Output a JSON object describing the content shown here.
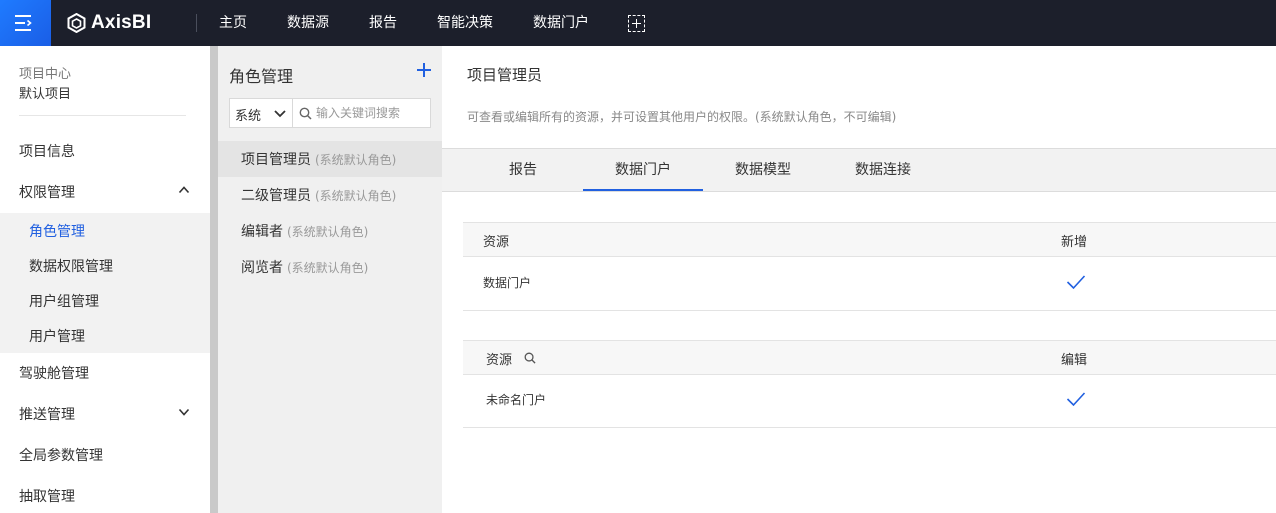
{
  "app": {
    "name": "AxisBI"
  },
  "topnav": [
    "主页",
    "数据源",
    "报告",
    "智能决策",
    "数据门户"
  ],
  "sidebar": {
    "project_label": "项目中心",
    "project_value": "默认项目",
    "items": [
      {
        "label": "项目信息"
      },
      {
        "label": "权限管理",
        "expanded": true
      },
      {
        "label": "驾驶舱管理"
      },
      {
        "label": "推送管理",
        "expanded": false
      },
      {
        "label": "全局参数管理"
      },
      {
        "label": "抽取管理"
      }
    ],
    "sub_items": [
      "角色管理",
      "数据权限管理",
      "用户组管理",
      "用户管理"
    ],
    "active_sub": "角色管理"
  },
  "roles_panel": {
    "title": "角色管理",
    "select_value": "系统",
    "search_placeholder": "输入关键词搜索",
    "roles": [
      {
        "name": "项目管理员",
        "tag": "(系统默认角色)",
        "active": true
      },
      {
        "name": "二级管理员",
        "tag": "(系统默认角色)"
      },
      {
        "name": "编辑者",
        "tag": "(系统默认角色)"
      },
      {
        "name": "阅览者",
        "tag": "(系统默认角色)"
      }
    ]
  },
  "detail": {
    "title": "项目管理员",
    "description": "可查看或编辑所有的资源，并可设置其他用户的权限。(系统默认角色，不可编辑)",
    "tabs": [
      "报告",
      "数据门户",
      "数据模型",
      "数据连接"
    ],
    "active_tab": "数据门户",
    "tables": [
      {
        "col1": "资源",
        "col2": "新增",
        "rows": [
          {
            "resource": "数据门户",
            "checked": true
          }
        ]
      },
      {
        "col1": "资源",
        "col2": "编辑",
        "rows": [
          {
            "resource": "未命名门户",
            "checked": true
          }
        ]
      }
    ]
  },
  "colors": {
    "accent": "#2160e0",
    "topbar": "#1c1f2b",
    "menu_button": "#1f7bff"
  }
}
